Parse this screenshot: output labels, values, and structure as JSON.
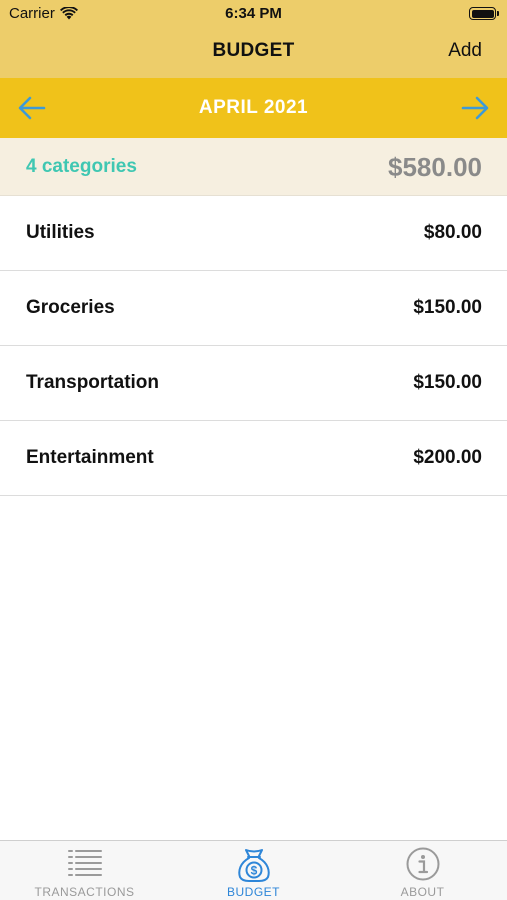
{
  "status_bar": {
    "carrier": "Carrier",
    "time": "6:34 PM"
  },
  "nav": {
    "title": "BUDGET",
    "add_label": "Add"
  },
  "month_bar": {
    "label": "APRIL 2021"
  },
  "summary": {
    "count_text": "4 categories",
    "total": "$580.00"
  },
  "categories": [
    {
      "name": "Utilities",
      "amount": "$80.00"
    },
    {
      "name": "Groceries",
      "amount": "$150.00"
    },
    {
      "name": "Transportation",
      "amount": "$150.00"
    },
    {
      "name": "Entertainment",
      "amount": "$200.00"
    }
  ],
  "tabs": [
    {
      "label": "TRANSACTIONS",
      "icon": "list-icon",
      "active": false
    },
    {
      "label": "BUDGET",
      "icon": "money-bag-icon",
      "active": true
    },
    {
      "label": "ABOUT",
      "icon": "info-icon",
      "active": false
    }
  ],
  "colors": {
    "header_bg": "#edcd6a",
    "month_bar_bg": "#f0c21a",
    "summary_bg": "#f6efe0",
    "accent_teal": "#3fc7b2",
    "arrow_blue": "#3d9ad8",
    "tab_active": "#2e86d8"
  }
}
